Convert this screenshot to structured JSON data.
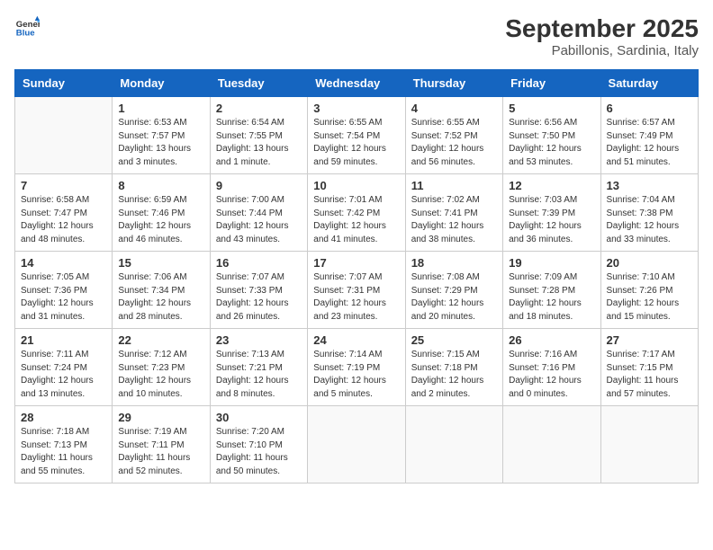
{
  "header": {
    "logo_general": "General",
    "logo_blue": "Blue",
    "title": "September 2025",
    "subtitle": "Pabillonis, Sardinia, Italy"
  },
  "days_of_week": [
    "Sunday",
    "Monday",
    "Tuesday",
    "Wednesday",
    "Thursday",
    "Friday",
    "Saturday"
  ],
  "weeks": [
    [
      {
        "day": "",
        "info": ""
      },
      {
        "day": "1",
        "info": "Sunrise: 6:53 AM\nSunset: 7:57 PM\nDaylight: 13 hours\nand 3 minutes."
      },
      {
        "day": "2",
        "info": "Sunrise: 6:54 AM\nSunset: 7:55 PM\nDaylight: 13 hours\nand 1 minute."
      },
      {
        "day": "3",
        "info": "Sunrise: 6:55 AM\nSunset: 7:54 PM\nDaylight: 12 hours\nand 59 minutes."
      },
      {
        "day": "4",
        "info": "Sunrise: 6:55 AM\nSunset: 7:52 PM\nDaylight: 12 hours\nand 56 minutes."
      },
      {
        "day": "5",
        "info": "Sunrise: 6:56 AM\nSunset: 7:50 PM\nDaylight: 12 hours\nand 53 minutes."
      },
      {
        "day": "6",
        "info": "Sunrise: 6:57 AM\nSunset: 7:49 PM\nDaylight: 12 hours\nand 51 minutes."
      }
    ],
    [
      {
        "day": "7",
        "info": "Sunrise: 6:58 AM\nSunset: 7:47 PM\nDaylight: 12 hours\nand 48 minutes."
      },
      {
        "day": "8",
        "info": "Sunrise: 6:59 AM\nSunset: 7:46 PM\nDaylight: 12 hours\nand 46 minutes."
      },
      {
        "day": "9",
        "info": "Sunrise: 7:00 AM\nSunset: 7:44 PM\nDaylight: 12 hours\nand 43 minutes."
      },
      {
        "day": "10",
        "info": "Sunrise: 7:01 AM\nSunset: 7:42 PM\nDaylight: 12 hours\nand 41 minutes."
      },
      {
        "day": "11",
        "info": "Sunrise: 7:02 AM\nSunset: 7:41 PM\nDaylight: 12 hours\nand 38 minutes."
      },
      {
        "day": "12",
        "info": "Sunrise: 7:03 AM\nSunset: 7:39 PM\nDaylight: 12 hours\nand 36 minutes."
      },
      {
        "day": "13",
        "info": "Sunrise: 7:04 AM\nSunset: 7:38 PM\nDaylight: 12 hours\nand 33 minutes."
      }
    ],
    [
      {
        "day": "14",
        "info": "Sunrise: 7:05 AM\nSunset: 7:36 PM\nDaylight: 12 hours\nand 31 minutes."
      },
      {
        "day": "15",
        "info": "Sunrise: 7:06 AM\nSunset: 7:34 PM\nDaylight: 12 hours\nand 28 minutes."
      },
      {
        "day": "16",
        "info": "Sunrise: 7:07 AM\nSunset: 7:33 PM\nDaylight: 12 hours\nand 26 minutes."
      },
      {
        "day": "17",
        "info": "Sunrise: 7:07 AM\nSunset: 7:31 PM\nDaylight: 12 hours\nand 23 minutes."
      },
      {
        "day": "18",
        "info": "Sunrise: 7:08 AM\nSunset: 7:29 PM\nDaylight: 12 hours\nand 20 minutes."
      },
      {
        "day": "19",
        "info": "Sunrise: 7:09 AM\nSunset: 7:28 PM\nDaylight: 12 hours\nand 18 minutes."
      },
      {
        "day": "20",
        "info": "Sunrise: 7:10 AM\nSunset: 7:26 PM\nDaylight: 12 hours\nand 15 minutes."
      }
    ],
    [
      {
        "day": "21",
        "info": "Sunrise: 7:11 AM\nSunset: 7:24 PM\nDaylight: 12 hours\nand 13 minutes."
      },
      {
        "day": "22",
        "info": "Sunrise: 7:12 AM\nSunset: 7:23 PM\nDaylight: 12 hours\nand 10 minutes."
      },
      {
        "day": "23",
        "info": "Sunrise: 7:13 AM\nSunset: 7:21 PM\nDaylight: 12 hours\nand 8 minutes."
      },
      {
        "day": "24",
        "info": "Sunrise: 7:14 AM\nSunset: 7:19 PM\nDaylight: 12 hours\nand 5 minutes."
      },
      {
        "day": "25",
        "info": "Sunrise: 7:15 AM\nSunset: 7:18 PM\nDaylight: 12 hours\nand 2 minutes."
      },
      {
        "day": "26",
        "info": "Sunrise: 7:16 AM\nSunset: 7:16 PM\nDaylight: 12 hours\nand 0 minutes."
      },
      {
        "day": "27",
        "info": "Sunrise: 7:17 AM\nSunset: 7:15 PM\nDaylight: 11 hours\nand 57 minutes."
      }
    ],
    [
      {
        "day": "28",
        "info": "Sunrise: 7:18 AM\nSunset: 7:13 PM\nDaylight: 11 hours\nand 55 minutes."
      },
      {
        "day": "29",
        "info": "Sunrise: 7:19 AM\nSunset: 7:11 PM\nDaylight: 11 hours\nand 52 minutes."
      },
      {
        "day": "30",
        "info": "Sunrise: 7:20 AM\nSunset: 7:10 PM\nDaylight: 11 hours\nand 50 minutes."
      },
      {
        "day": "",
        "info": ""
      },
      {
        "day": "",
        "info": ""
      },
      {
        "day": "",
        "info": ""
      },
      {
        "day": "",
        "info": ""
      }
    ]
  ]
}
